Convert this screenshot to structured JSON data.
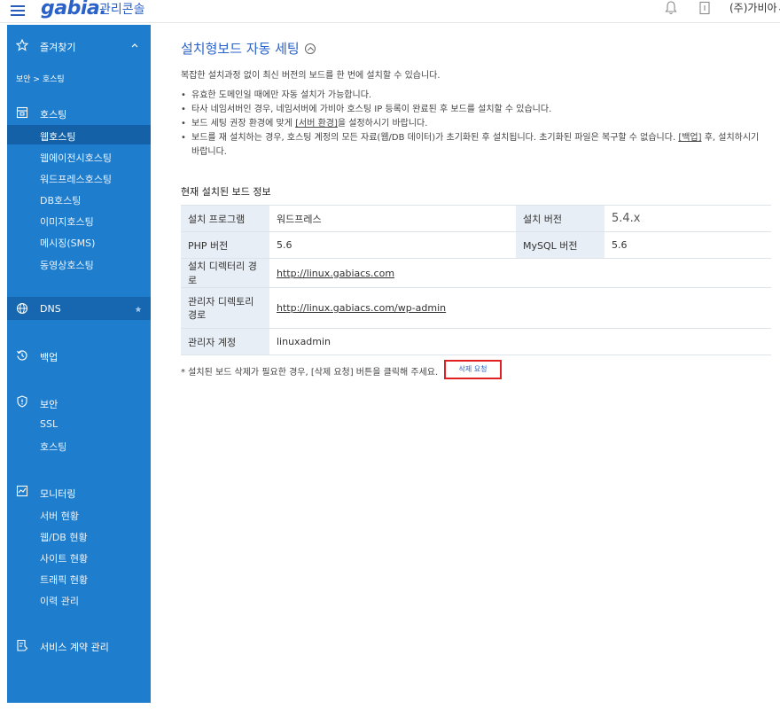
{
  "header": {
    "logo": "gabia.",
    "console_title": "관리콘솔",
    "company": "(주)가비아"
  },
  "sidebar": {
    "favorites_label": "즐겨찾기",
    "breadcrumb": "보안 > 호스팅",
    "hosting": {
      "label": "호스팅",
      "items": [
        "웹호스팅",
        "웹에이전시호스팅",
        "워드프레스호스팅",
        "DB호스팅",
        "이미지호스팅",
        "메시징(SMS)",
        "동영상호스팅"
      ]
    },
    "dns_label": "DNS",
    "backup_label": "백업",
    "security": {
      "label": "보안",
      "items": [
        "SSL",
        "호스팅"
      ]
    },
    "monitoring": {
      "label": "모니터링",
      "items": [
        "서버 현황",
        "웹/DB 현황",
        "사이트 현황",
        "트래픽 현황",
        "이력 관리"
      ]
    },
    "contract_label": "서비스 계약 관리"
  },
  "main": {
    "title": "설치형보드 자동 세팅",
    "intro": "복잡한 설치과정 없이 최신 버전의 보드를 한 번에 설치할 수 있습니다.",
    "notes": [
      "유효한 도메인일 때에만 자동 설치가 가능합니다.",
      "타사 네임서버인 경우, 네임서버에 가비아 호스팅 IP 등록이 완료된 후 보드를 설치할 수 있습니다."
    ],
    "note3_pre": "보드 세팅 권장 환경에 맞게 ",
    "note3_link": "[서버 환경]",
    "note3_post": "을 설정하시기 바랍니다.",
    "note4_pre": "보드를 재 설치하는 경우, 호스팅 계정의 모든 자료(웹/DB 데이터)가 초기화된 후 설치됩니다. 초기화된 파일은 복구할 수 없습니다. ",
    "note4_link": "[백업]",
    "note4_post": " 후, 설치하시기 바랍니다.",
    "section_title": "현재 설치된 보드 정보",
    "table": {
      "program_label": "설치 프로그램",
      "program_value": "워드프레스",
      "version_label": "설치 버전",
      "version_value": "5.4.x",
      "php_label": "PHP 버전",
      "php_value": "5.6",
      "mysql_label": "MySQL 버전",
      "mysql_value": "5.6",
      "dir_label": "설치 디렉터리 경로",
      "dir_value": "http://linux.gabiacs.com",
      "admin_dir_label": "관리자 디렉토리 경로",
      "admin_dir_value": "http://linux.gabiacs.com/wp-admin",
      "admin_account_label": "관리자 계정",
      "admin_account_value": "linuxadmin"
    },
    "footnote": "* 설치된 보드 삭제가 필요한 경우, [삭제 요청] 버튼을 클릭해 주세요.",
    "delete_button": "삭제 요청"
  }
}
